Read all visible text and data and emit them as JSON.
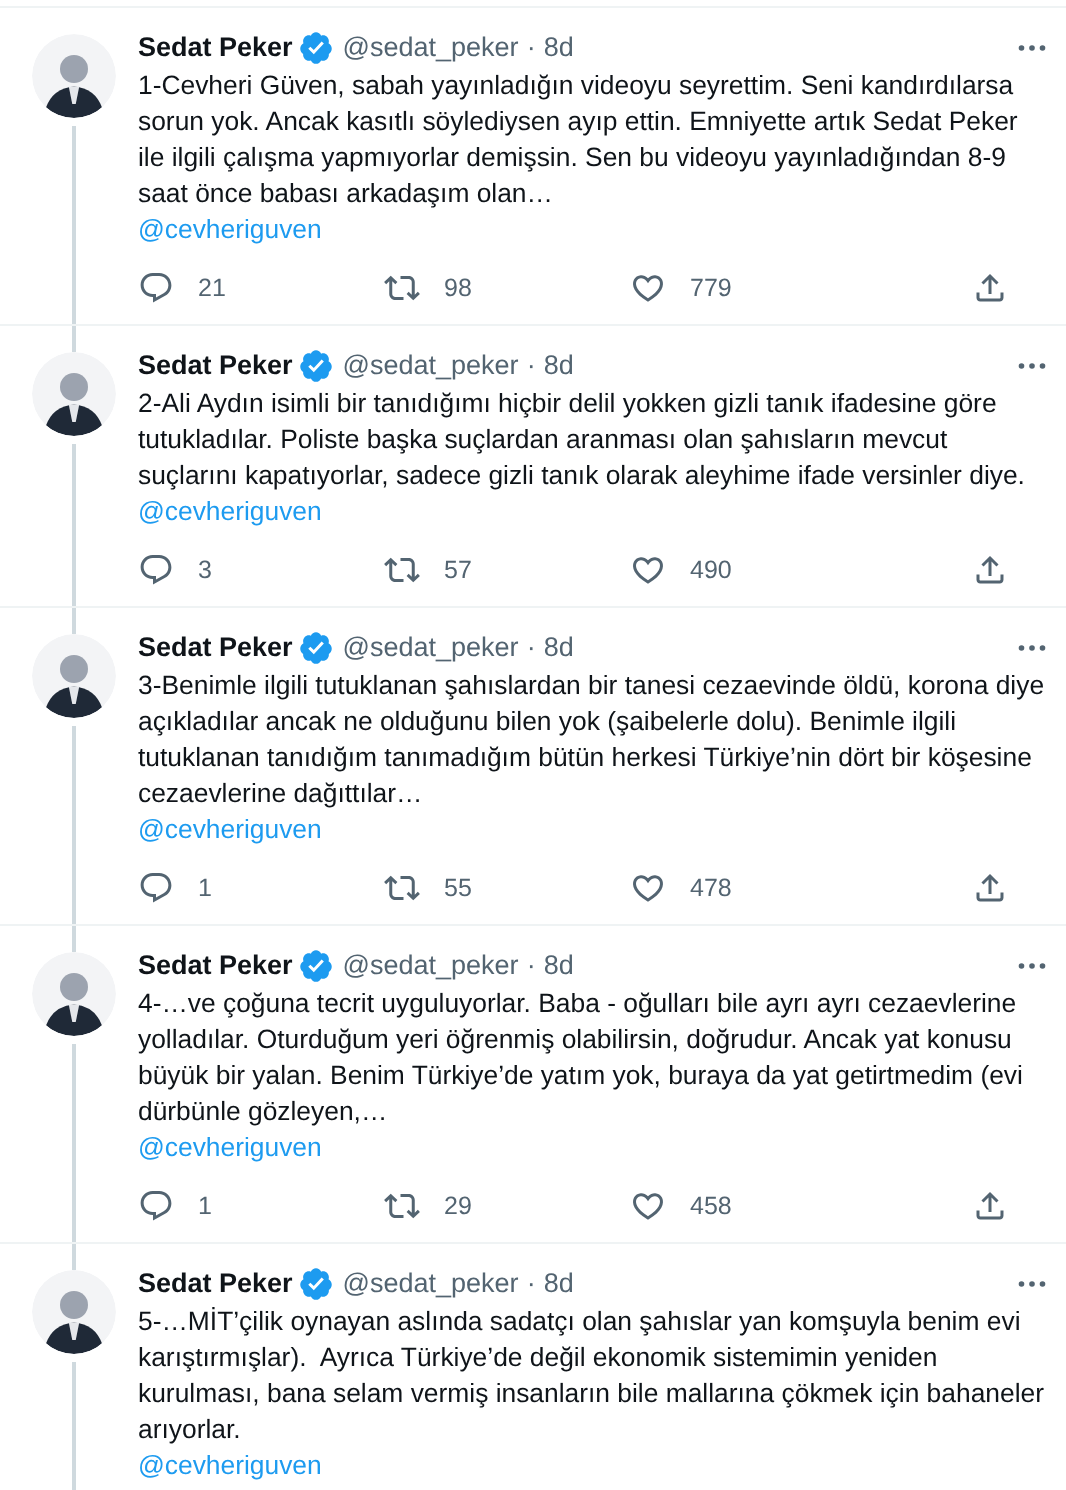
{
  "tweets": [
    {
      "name": "Sedat Peker",
      "verified": true,
      "handle": "@sedat_peker",
      "separator": "·",
      "time": "8d",
      "text": "1-Cevheri Güven, sabah yayınladığın videoyu seyrettim. Seni kandırdılarsa sorun yok. Ancak kasıtlı söylediysen ayıp ettin. Emniyette artık Sedat Peker ile ilgili çalışma yapmıyorlar demişsin. Sen bu videoyu yayınladığından 8-9 saat önce babası arkadaşım olan…",
      "mention": "@cevheriguven",
      "replies": "21",
      "retweets": "98",
      "likes": "779",
      "thread_line_above": false,
      "thread_line_below": true
    },
    {
      "name": "Sedat Peker",
      "verified": true,
      "handle": "@sedat_peker",
      "separator": "·",
      "time": "8d",
      "text": "2-Ali Aydın isimli bir tanıdığımı hiçbir delil yokken gizli tanık ifadesine göre tutukladılar. Poliste başka suçlardan aranması olan şahısların mevcut suçlarını kapatıyorlar, sadece gizli tanık olarak aleyhime ifade versinler diye.",
      "mention": "@cevheriguven",
      "replies": "3",
      "retweets": "57",
      "likes": "490",
      "thread_line_above": true,
      "thread_line_below": true
    },
    {
      "name": "Sedat Peker",
      "verified": true,
      "handle": "@sedat_peker",
      "separator": "·",
      "time": "8d",
      "text": "3-Benimle ilgili tutuklanan şahıslardan bir tanesi cezaevinde öldü, korona diye açıkladılar ancak ne olduğunu bilen yok (şaibelerle dolu). Benimle ilgili tutuklanan tanıdığım tanımadığım bütün herkesi Türkiye’nin dört bir köşesine cezaevlerine dağıttılar…",
      "mention": "@cevheriguven",
      "replies": "1",
      "retweets": "55",
      "likes": "478",
      "thread_line_above": true,
      "thread_line_below": true
    },
    {
      "name": "Sedat Peker",
      "verified": true,
      "handle": "@sedat_peker",
      "separator": "·",
      "time": "8d",
      "text": "4-…ve çoğuna tecrit uyguluyorlar. Baba - oğulları bile ayrı ayrı cezaevlerine yolladılar. Oturduğum yeri öğrenmiş olabilirsin, doğrudur. Ancak yat konusu büyük bir yalan. Benim Türkiye’de yatım yok, buraya da yat getirtmedim (evi dürbünle gözleyen,…",
      "mention": "@cevheriguven",
      "replies": "1",
      "retweets": "29",
      "likes": "458",
      "thread_line_above": true,
      "thread_line_below": true
    },
    {
      "name": "Sedat Peker",
      "verified": true,
      "handle": "@sedat_peker",
      "separator": "·",
      "time": "8d",
      "text": "5-…MİT’çilik oynayan aslında sadatçı olan şahıslar yan komşuyla benim evi karıştırmışlar).  Ayrıca Türkiye’de değil ekonomik sistemimin yeniden kurulması, bana selam vermiş insanların bile mallarına çökmek için bahaneler arıyorlar.",
      "mention": "@cevheriguven",
      "thread_line_above": true,
      "thread_line_below": true
    }
  ]
}
